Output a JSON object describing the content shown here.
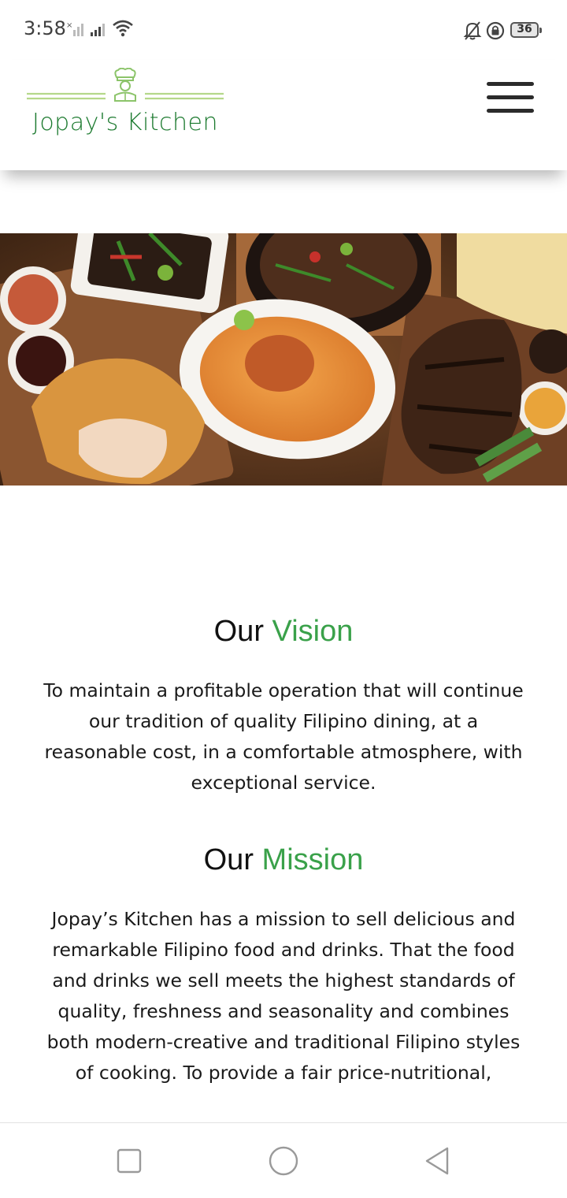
{
  "status_bar": {
    "time": "3:58",
    "battery": "36",
    "icons": [
      "no-sim-signal-icon",
      "signal-icon",
      "wifi-icon",
      "bell-off-icon",
      "lock-rotation-icon",
      "battery-icon"
    ]
  },
  "header": {
    "brand": "Jopay's Kitchen",
    "logo_icon": "chef-icon",
    "menu_icon": "hamburger-icon",
    "brand_color": "#1c7a2f",
    "accent_line_color": "#b5d88a"
  },
  "hero": {
    "image": "filipino-food-spread"
  },
  "vision": {
    "heading_prefix": "Our",
    "heading_accent": "Vision",
    "text": "To maintain a profitable operation that will continue our tradition of quality Filipino dining, at a reasonable cost, in a comfortable atmosphere, with exceptional service."
  },
  "mission": {
    "heading_prefix": "Our",
    "heading_accent": "Mission",
    "text": "Jopay’s Kitchen has a mission to sell delicious and remarkable Filipino food and drinks. That the food and drinks we sell meets the highest standards of quality, freshness and seasonality and combines both modern-creative and traditional Filipino styles of cooking. To provide a fair price-nutritional,"
  },
  "colors": {
    "accent": "#3aa14a",
    "text": "#111111"
  },
  "nav_bar": {
    "icons": [
      "recents-square-icon",
      "home-circle-icon",
      "back-triangle-icon"
    ]
  }
}
